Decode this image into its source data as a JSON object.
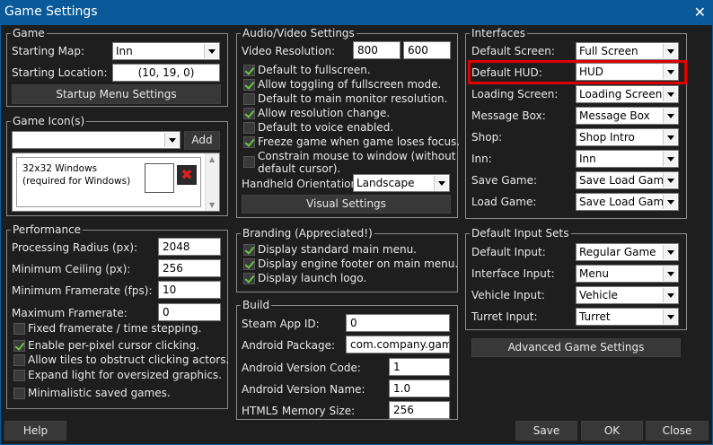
{
  "window": {
    "title": "Game Settings"
  },
  "game": {
    "legend": "Game",
    "starting_map_label": "Starting Map:",
    "starting_map_value": "Inn",
    "starting_location_label": "Starting Location:",
    "starting_location_value": "(10, 19, 0)",
    "startup_menu_button": "Startup Menu Settings"
  },
  "game_icons": {
    "legend": "Game Icon(s)",
    "icon_select_value": "",
    "add_button": "Add",
    "item_text": "32x32 Windows (required for Windows)"
  },
  "performance": {
    "legend": "Performance",
    "processing_radius_label": "Processing Radius (px):",
    "processing_radius_value": "2048",
    "minimum_ceiling_label": "Minimum Ceiling (px):",
    "minimum_ceiling_value": "256",
    "minimum_framerate_label": "Minimum Framerate (fps):",
    "minimum_framerate_value": "10",
    "maximum_framerate_label": "Maximum Framerate:",
    "maximum_framerate_value": "0",
    "checkboxes": [
      {
        "label": "Fixed framerate / time stepping.",
        "checked": false
      },
      {
        "label": "Enable per-pixel cursor clicking.",
        "checked": true
      },
      {
        "label": "Allow tiles to obstruct clicking actors.",
        "checked": false
      },
      {
        "label": "Expand light for oversized graphics.",
        "checked": false
      },
      {
        "label": "Minimalistic saved games.",
        "checked": false
      }
    ]
  },
  "audio_video": {
    "legend": "Audio/Video Settings",
    "resolution_label": "Video Resolution:",
    "resolution_width": "800",
    "resolution_height": "600",
    "checkboxes": [
      {
        "label": "Default to fullscreen.",
        "checked": true
      },
      {
        "label": "Allow toggling of fullscreen mode.",
        "checked": true
      },
      {
        "label": "Default to main monitor resolution.",
        "checked": false
      },
      {
        "label": "Allow resolution change.",
        "checked": true
      },
      {
        "label": "Default to voice enabled.",
        "checked": false
      },
      {
        "label": "Freeze game when game loses focus.",
        "checked": true
      }
    ],
    "constrain_label_line1": "Constrain mouse to window (without",
    "constrain_label_line2": "default cursor).",
    "constrain_checked": false,
    "orientation_label": "Handheld Orientation:",
    "orientation_value": "Landscape",
    "visual_settings_button": "Visual Settings"
  },
  "branding": {
    "legend": "Branding (Appreciated!)",
    "checkboxes": [
      {
        "label": "Display standard main menu.",
        "checked": true
      },
      {
        "label": "Display engine footer on main menu.",
        "checked": true
      },
      {
        "label": "Display launch logo.",
        "checked": true
      }
    ]
  },
  "build": {
    "legend": "Build",
    "steam_label": "Steam App ID:",
    "steam_value": "0",
    "android_package_label": "Android Package:",
    "android_package_value": "com.company.game",
    "android_version_code_label": "Android Version Code:",
    "android_version_code_value": "1",
    "android_version_name_label": "Android Version Name:",
    "android_version_name_value": "1.0",
    "html5_memory_label": "HTML5 Memory Size:",
    "html5_memory_value": "256"
  },
  "interfaces": {
    "legend": "Interfaces",
    "rows": [
      {
        "label": "Default Screen:",
        "value": "Full Screen"
      },
      {
        "label": "Default HUD:",
        "value": "HUD"
      },
      {
        "label": "Loading Screen:",
        "value": "Loading Screen"
      },
      {
        "label": "Message Box:",
        "value": "Message Box"
      },
      {
        "label": "Shop:",
        "value": "Shop Intro"
      },
      {
        "label": "Inn:",
        "value": "Inn"
      },
      {
        "label": "Save Game:",
        "value": "Save Load Game"
      },
      {
        "label": "Load Game:",
        "value": "Save Load Game"
      }
    ]
  },
  "input_sets": {
    "legend": "Default Input Sets",
    "rows": [
      {
        "label": "Default Input:",
        "value": "Regular Game"
      },
      {
        "label": "Interface Input:",
        "value": "Menu"
      },
      {
        "label": "Vehicle Input:",
        "value": "Vehicle"
      },
      {
        "label": "Turret Input:",
        "value": "Turret"
      }
    ],
    "advanced_button": "Advanced Game Settings"
  },
  "footer": {
    "help": "Help",
    "save": "Save",
    "ok": "OK",
    "close": "Close"
  },
  "colors": {
    "titlebar": "#0a5a9a",
    "background": "#1e1e1e",
    "highlight": "#e00000",
    "check": "#6ec04a"
  }
}
